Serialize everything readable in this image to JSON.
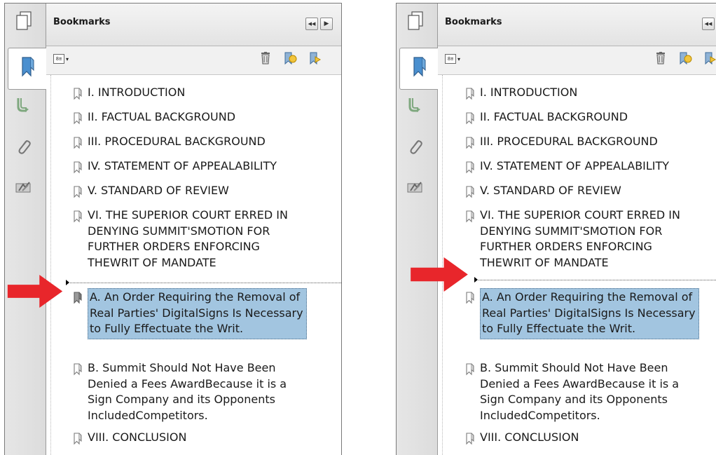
{
  "header": {
    "title": "Bookmarks",
    "collapse_icon": "rewind-icon",
    "expand_icon": "play-icon"
  },
  "toolbar": {
    "options_icon": "options-list-icon",
    "delete_icon": "trash-icon",
    "new_bookmark_icon": "new-bookmark-icon",
    "expand_bookmark_icon": "bookmark-expand-icon"
  },
  "nav": {
    "items": [
      "pages-icon",
      "bookmarks-icon",
      "signatures-icon",
      "attachments-icon",
      "layers-icon"
    ]
  },
  "bookmarks": [
    {
      "lines": [
        "I. INTRODUCTION"
      ]
    },
    {
      "lines": [
        "II. FACTUAL BACKGROUND"
      ]
    },
    {
      "lines": [
        "III. PROCEDURAL BACKGROUND"
      ]
    },
    {
      "lines": [
        "IV. STATEMENT OF APPEALABILITY"
      ]
    },
    {
      "lines": [
        "V. STANDARD OF REVIEW"
      ]
    },
    {
      "lines": [
        "VI. THE SUPERIOR COURT ERRED IN",
        "DENYING SUMMIT'SMOTION FOR",
        "FURTHER ORDERS ENFORCING",
        "THEWRIT OF MANDATE"
      ]
    },
    {
      "lines": [
        "A. An Order Requiring the Removal of",
        "Real Parties' DigitalSigns Is Necessary",
        "to Fully Effectuate the Writ."
      ],
      "selected": true
    },
    {
      "lines": [
        "B. Summit Should Not Have Been",
        "Denied a Fees AwardBecause it is a",
        "Sign Company and its Opponents",
        "IncludedCompetitors."
      ]
    },
    {
      "lines": [
        "VIII. CONCLUSION"
      ]
    }
  ],
  "colors": {
    "selection": "#a2c5e0",
    "arrow": "#e8262b"
  }
}
